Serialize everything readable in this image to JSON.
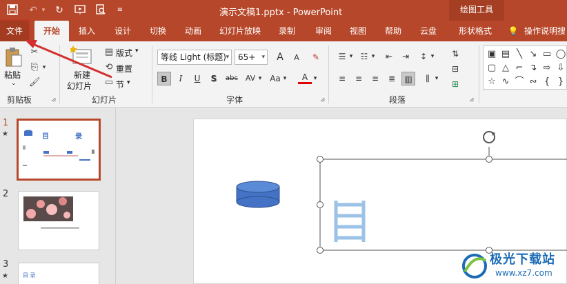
{
  "titlebar": {
    "doc_title": "演示文稿1.pptx  -  PowerPoint",
    "tools_label": "绘图工具"
  },
  "tabs": [
    "文件",
    "开始",
    "插入",
    "设计",
    "切换",
    "动画",
    "幻灯片放映",
    "录制",
    "审阅",
    "视图",
    "帮助",
    "云盘",
    "形状格式",
    "操作说明搜"
  ],
  "ribbon": {
    "clipboard": {
      "paste": "粘贴",
      "group": "剪贴板"
    },
    "slides": {
      "new_line1": "新建",
      "new_line2": "幻灯片",
      "layout": "版式",
      "reset": "重置",
      "section": "节",
      "group": "幻灯片"
    },
    "font": {
      "name": "等线 Light (标题)",
      "size": "65+",
      "grow": "A",
      "shrink": "A",
      "bold": "B",
      "italic": "I",
      "underline": "U",
      "shadow": "S",
      "strike": "abc",
      "spacing": "AV",
      "case": "Aa",
      "color": "A",
      "group": "字体"
    },
    "paragraph": {
      "group": "段落"
    }
  },
  "thumbnails": [
    {
      "num": "1",
      "selected": true,
      "title_left": "目",
      "title_right": "录"
    },
    {
      "num": "2",
      "selected": false
    },
    {
      "num": "3",
      "selected": false,
      "title": "目 录"
    }
  ],
  "watermark": {
    "text": "极光下载站",
    "url": "www.xz7.com"
  },
  "colors": {
    "accent": "#b7472a",
    "shape_fill": "#4472c4",
    "arrow": "#d32f2f"
  }
}
